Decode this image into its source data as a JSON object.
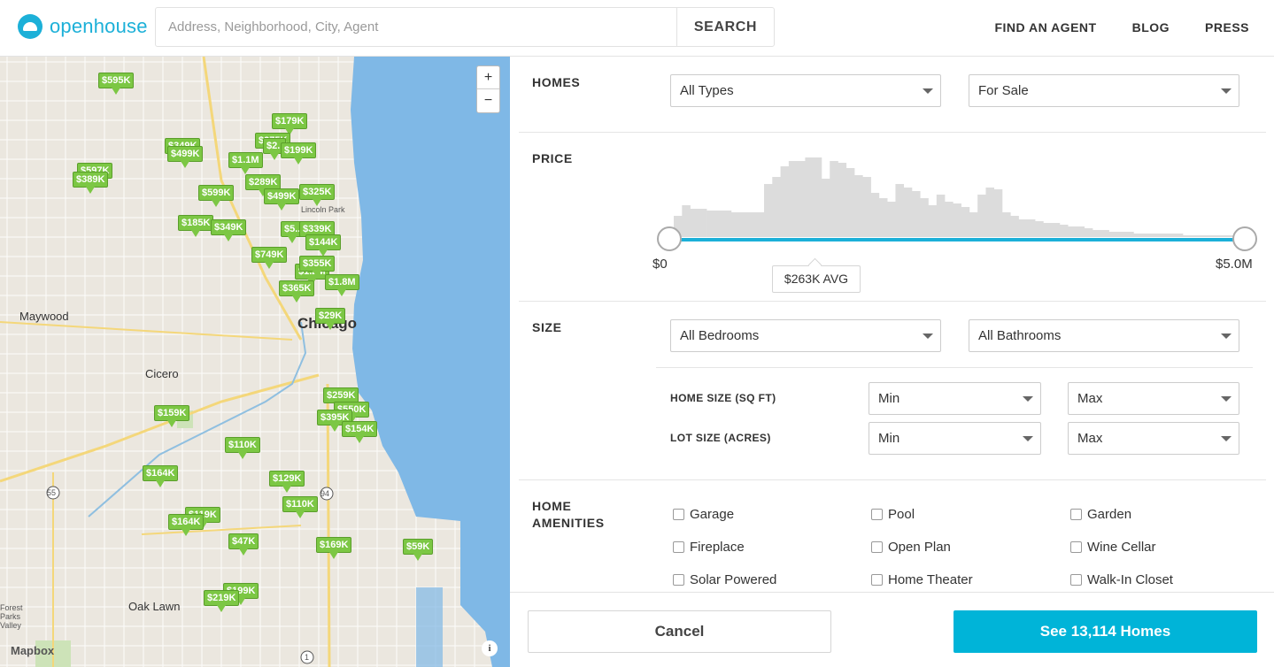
{
  "header": {
    "logo_text": "openhouse",
    "search_placeholder": "Address, Neighborhood, City, Agent",
    "search_button": "SEARCH",
    "nav": [
      "FIND AN AGENT",
      "BLOG",
      "PRESS"
    ]
  },
  "map": {
    "zoom_in": "+",
    "zoom_out": "−",
    "attribution": "Mapbox",
    "info": "i",
    "place_labels": [
      "Maywood",
      "Cicero",
      "Chicago",
      "Oak Lawn",
      "Lincoln Park",
      "Forest Parks Valley"
    ],
    "price_pins": [
      "$595K",
      "$179K",
      "$275K",
      "$2..",
      "$199K",
      "$349K",
      "$499K",
      "$1.1M",
      "$597K",
      "$389K",
      "$289K",
      "$599K",
      "$499K",
      "$325K",
      "$185K",
      "$349K",
      "$5..",
      "$339K",
      "$144K",
      "$749K",
      "$1.2M",
      "$355K",
      "$1.8M",
      "$365K",
      "$29K",
      "$259K",
      "$159K",
      "$550K",
      "$395K",
      "$154K",
      "$110K",
      "$164K",
      "$129K",
      "$110K",
      "$119K",
      "$164K",
      "$47K",
      "$169K",
      "$59K",
      "$199K",
      "$219K"
    ],
    "road_shields": [
      "55",
      "94",
      "1"
    ]
  },
  "filters": {
    "homes": {
      "title": "HOMES",
      "type_value": "All Types",
      "status_value": "For Sale"
    },
    "price": {
      "title": "PRICE",
      "min_label": "$0",
      "max_label": "$5.0M",
      "avg_label": "$263K AVG",
      "histogram": [
        0.12,
        0.18,
        0.16,
        0.16,
        0.15,
        0.15,
        0.15,
        0.14,
        0.14,
        0.14,
        0.14,
        0.3,
        0.34,
        0.4,
        0.43,
        0.43,
        0.45,
        0.45,
        0.33,
        0.43,
        0.42,
        0.39,
        0.35,
        0.34,
        0.25,
        0.22,
        0.2,
        0.3,
        0.28,
        0.26,
        0.22,
        0.18,
        0.24,
        0.2,
        0.19,
        0.17,
        0.14,
        0.24,
        0.28,
        0.27,
        0.14,
        0.12,
        0.1,
        0.1,
        0.09,
        0.08,
        0.08,
        0.07,
        0.06,
        0.06,
        0.05,
        0.04,
        0.04,
        0.03,
        0.03,
        0.03,
        0.02,
        0.02,
        0.02,
        0.02,
        0.02,
        0.02,
        0.01,
        0.01,
        0.01,
        0.01,
        0.01,
        0.01,
        0.01
      ]
    },
    "size": {
      "title": "SIZE",
      "bedrooms_value": "All Bedrooms",
      "bathrooms_value": "All Bathrooms",
      "home_size_label": "HOME SIZE (SQ FT)",
      "lot_size_label": "LOT SIZE (ACRES)",
      "home_min": "Min",
      "home_max": "Max",
      "lot_min": "Min",
      "lot_max": "Max"
    },
    "amenities": {
      "title": "HOME AMENITIES",
      "items": [
        "Garage",
        "Pool",
        "Garden",
        "Fireplace",
        "Open Plan",
        "Wine Cellar",
        "Solar Powered",
        "Home Theater",
        "Walk-In Closet"
      ]
    }
  },
  "footer": {
    "cancel": "Cancel",
    "see_homes": "See 13,114 Homes"
  },
  "colors": {
    "accent": "#1cb0d8",
    "button": "#00b4d8",
    "pin": "#7cc744",
    "water": "#7fb8e6"
  }
}
